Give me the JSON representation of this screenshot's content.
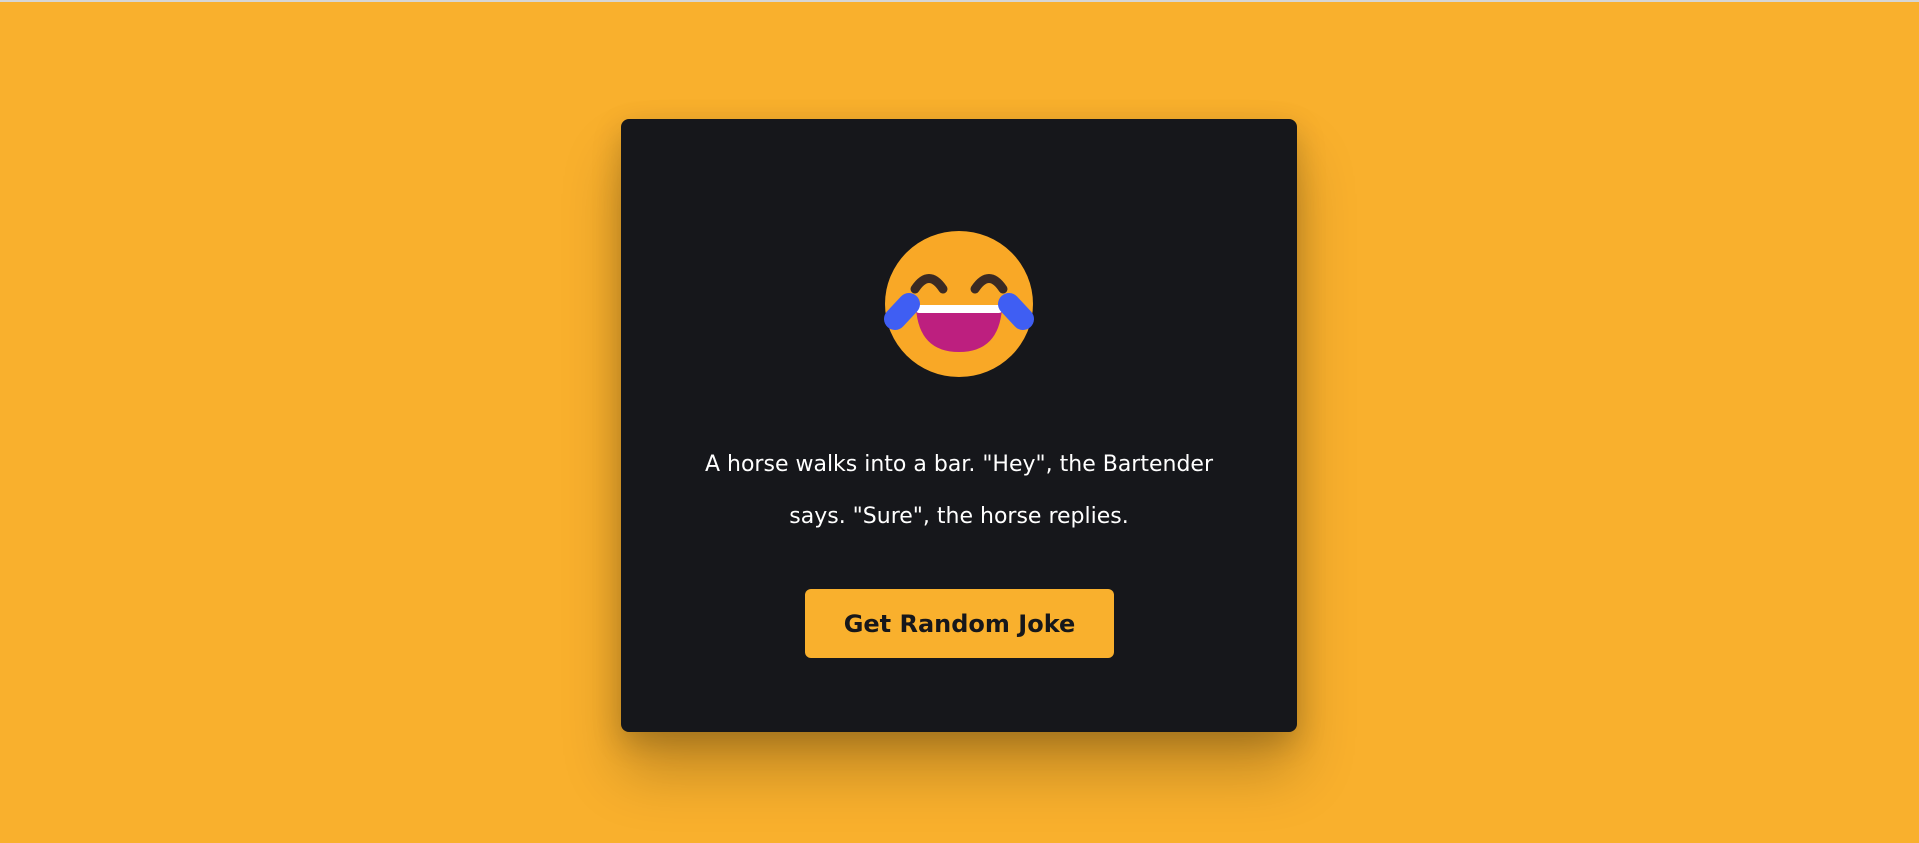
{
  "joke": {
    "text": "A horse walks into a bar. \"Hey\", the Bartender says. \"Sure\", the horse replies.",
    "icon": "laughing-tears-emoji-icon"
  },
  "button": {
    "label": "Get Random Joke"
  },
  "colors": {
    "background": "#f9b02d",
    "card": "#16171b",
    "accent": "#f9b02d",
    "text": "#ffffff"
  }
}
